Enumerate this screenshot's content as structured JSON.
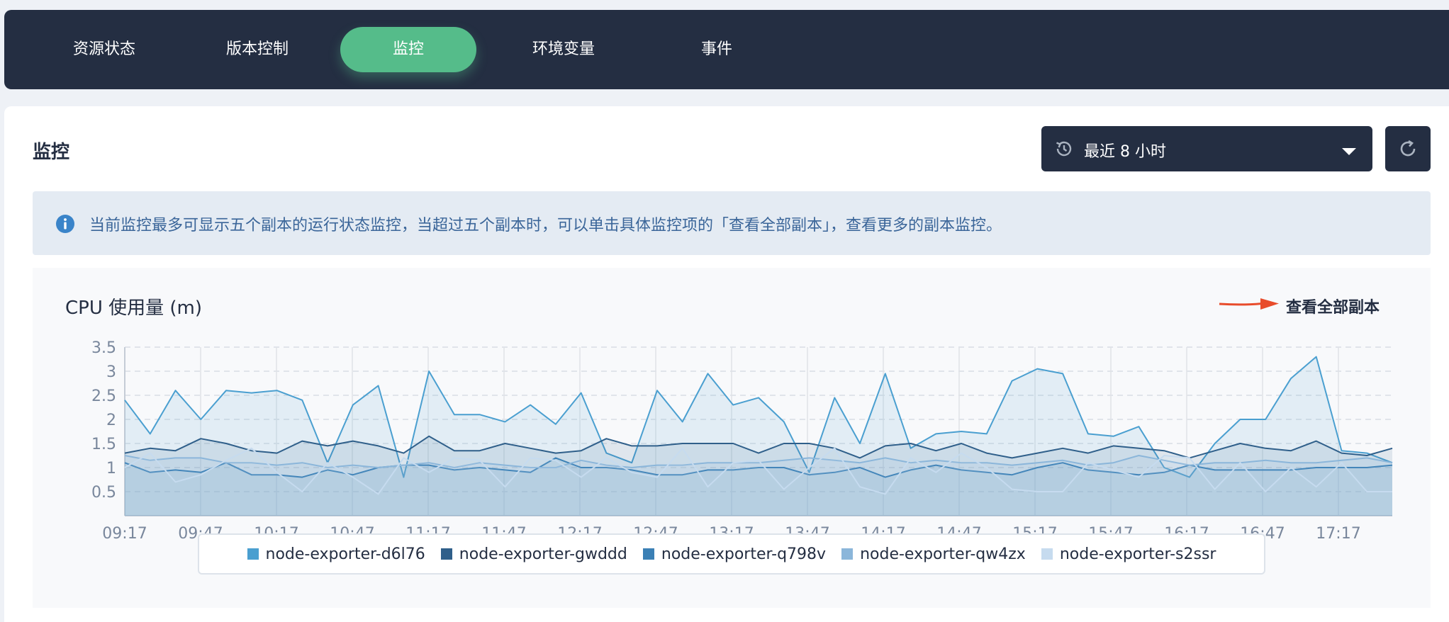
{
  "tabs": [
    {
      "label": "资源状态",
      "active": false
    },
    {
      "label": "版本控制",
      "active": false
    },
    {
      "label": "监控",
      "active": true
    },
    {
      "label": "环境变量",
      "active": false
    },
    {
      "label": "事件",
      "active": false
    }
  ],
  "panel": {
    "title": "监控",
    "time_range": "最近 8 小时",
    "notice": "当前监控最多可显示五个副本的运行状态监控，当超过五个副本时，可以单击具体监控项的「查看全部副本」，查看更多的副本监控。"
  },
  "colors": {
    "accent": "#55bc8a",
    "dark": "#242e42",
    "info": "#3a6599",
    "arrow": "#e84c2b"
  },
  "icons": {
    "time": "history-clock-icon",
    "dropdown": "caret-down-icon",
    "refresh": "refresh-icon",
    "info": "info-icon",
    "arrow": "arrow-right-icon"
  },
  "chart": {
    "title": "CPU 使用量 (m)",
    "view_all": "查看全部副本"
  },
  "chart_data": {
    "type": "area",
    "title": "CPU 使用量 (m)",
    "xlabel": "",
    "ylabel": "",
    "ylim": [
      0,
      3.5
    ],
    "yticks": [
      "0.5",
      "1",
      "1.5",
      "2",
      "2.5",
      "3",
      "3.5"
    ],
    "x_ticks": [
      "09:17",
      "09:47",
      "10:17",
      "10:47",
      "11:17",
      "11:47",
      "12:17",
      "12:47",
      "13:17",
      "13:47",
      "14:17",
      "14:47",
      "15:17",
      "15:47",
      "16:17",
      "16:47",
      "17:17"
    ],
    "grid": true,
    "legend_position": "bottom",
    "series": [
      {
        "name": "node-exporter-d6l76",
        "color": "#4a9fd0",
        "values": [
          2.4,
          1.7,
          2.6,
          2.0,
          2.6,
          2.55,
          2.6,
          2.4,
          1.1,
          2.3,
          2.7,
          0.8,
          3.0,
          2.1,
          2.1,
          1.95,
          2.3,
          1.9,
          2.55,
          1.3,
          1.1,
          2.6,
          1.95,
          2.95,
          2.3,
          2.45,
          1.95,
          0.9,
          2.45,
          1.5,
          2.95,
          1.4,
          1.7,
          1.75,
          1.7,
          2.8,
          3.05,
          2.95,
          1.7,
          1.65,
          1.85,
          1.0,
          0.8,
          1.5,
          2.0,
          2.0,
          2.85,
          3.3,
          1.35,
          1.3,
          1.1
        ]
      },
      {
        "name": "node-exporter-gwddd",
        "color": "#2f5f8a",
        "values": [
          1.3,
          1.4,
          1.35,
          1.6,
          1.5,
          1.35,
          1.3,
          1.55,
          1.45,
          1.55,
          1.45,
          1.3,
          1.65,
          1.35,
          1.35,
          1.5,
          1.4,
          1.3,
          1.35,
          1.6,
          1.45,
          1.45,
          1.5,
          1.5,
          1.5,
          1.3,
          1.5,
          1.5,
          1.4,
          1.2,
          1.45,
          1.5,
          1.35,
          1.5,
          1.3,
          1.2,
          1.3,
          1.4,
          1.3,
          1.45,
          1.4,
          1.35,
          1.2,
          1.35,
          1.5,
          1.4,
          1.35,
          1.55,
          1.3,
          1.25,
          1.4
        ]
      },
      {
        "name": "node-exporter-q798v",
        "color": "#3b80b5",
        "values": [
          1.1,
          0.9,
          0.95,
          0.9,
          1.1,
          0.85,
          0.85,
          0.8,
          0.95,
          0.85,
          1.0,
          1.05,
          1.05,
          0.95,
          1.0,
          0.95,
          0.9,
          1.2,
          1.0,
          1.0,
          0.95,
          0.85,
          0.85,
          0.95,
          0.95,
          1.0,
          1.0,
          0.85,
          0.9,
          1.0,
          0.8,
          0.95,
          1.05,
          0.95,
          0.9,
          0.85,
          1.0,
          1.1,
          0.95,
          0.9,
          0.85,
          0.9,
          1.05,
          0.95,
          0.95,
          0.95,
          0.95,
          1.0,
          1.0,
          1.0,
          1.05
        ]
      },
      {
        "name": "node-exporter-qw4zx",
        "color": "#8bb6da",
        "values": [
          1.25,
          1.15,
          1.2,
          1.2,
          1.1,
          1.1,
          1.05,
          1.1,
          1.0,
          1.05,
          1.0,
          1.05,
          1.1,
          1.0,
          1.1,
          1.05,
          1.0,
          1.0,
          1.15,
          1.05,
          1.0,
          1.05,
          1.05,
          1.1,
          1.1,
          1.1,
          1.15,
          1.2,
          1.15,
          1.1,
          1.2,
          1.1,
          1.15,
          1.1,
          1.1,
          1.05,
          1.1,
          1.15,
          1.05,
          1.1,
          1.25,
          1.15,
          1.05,
          1.1,
          1.1,
          1.15,
          1.1,
          1.1,
          1.15,
          1.2,
          1.1
        ]
      },
      {
        "name": "node-exporter-s2ssr",
        "color": "#c6dbef",
        "values": [
          1.0,
          1.3,
          0.7,
          0.85,
          1.15,
          1.4,
          0.9,
          0.5,
          1.1,
          0.8,
          0.45,
          1.2,
          0.9,
          1.2,
          1.15,
          0.6,
          1.2,
          1.15,
          0.8,
          1.2,
          0.9,
          0.8,
          1.4,
          0.6,
          1.1,
          1.15,
          0.55,
          1.0,
          1.4,
          0.6,
          0.45,
          1.2,
          0.9,
          1.3,
          1.0,
          0.55,
          0.5,
          0.5,
          1.1,
          0.95,
          0.8,
          1.25,
          1.2,
          0.55,
          1.1,
          0.5,
          1.0,
          0.6,
          1.1,
          0.5,
          0.5
        ]
      }
    ]
  }
}
